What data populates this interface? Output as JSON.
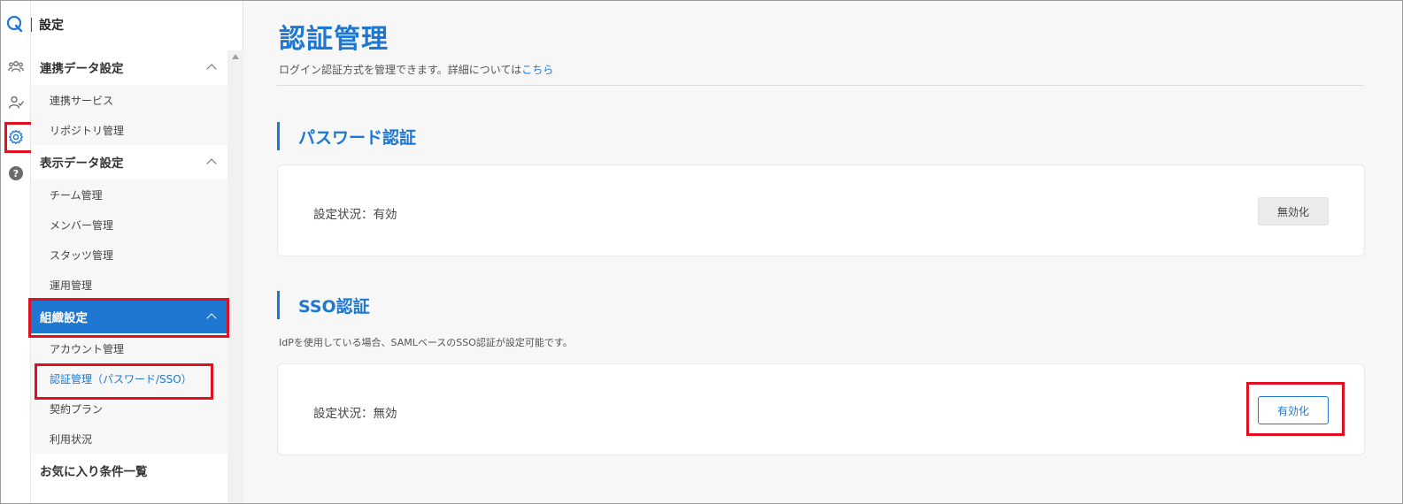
{
  "sidebar": {
    "title": "設定",
    "sections": [
      {
        "label": "連携データ設定",
        "items": [
          "連携サービス",
          "リポジトリ管理"
        ]
      },
      {
        "label": "表示データ設定",
        "items": [
          "チーム管理",
          "メンバー管理",
          "スタッツ管理",
          "運用管理"
        ]
      },
      {
        "label": "組織設定",
        "items": [
          "アカウント管理",
          "認証管理（パスワード/SSO）",
          "契約プラン",
          "利用状況"
        ]
      }
    ],
    "favorites_label": "お気に入り条件一覧"
  },
  "rail": {
    "icons": [
      "app-logo-icon",
      "team-icon",
      "member-check-icon",
      "gear-icon",
      "help-icon"
    ],
    "accent": "#1e78d2"
  },
  "main": {
    "title": "認証管理",
    "description": "ログイン認証方式を管理できます。詳細については",
    "description_link": "こちら",
    "password": {
      "heading": "パスワード認証",
      "status": "設定状況：有効",
      "button": "無効化"
    },
    "sso": {
      "heading": "SSO認証",
      "note": "IdPを使用している場合、SAMLベースのSSO認証が設定可能です。",
      "status": "設定状況：無効",
      "button": "有効化"
    }
  },
  "colors": {
    "accent": "#1e78d2",
    "highlight": "#e01020"
  }
}
